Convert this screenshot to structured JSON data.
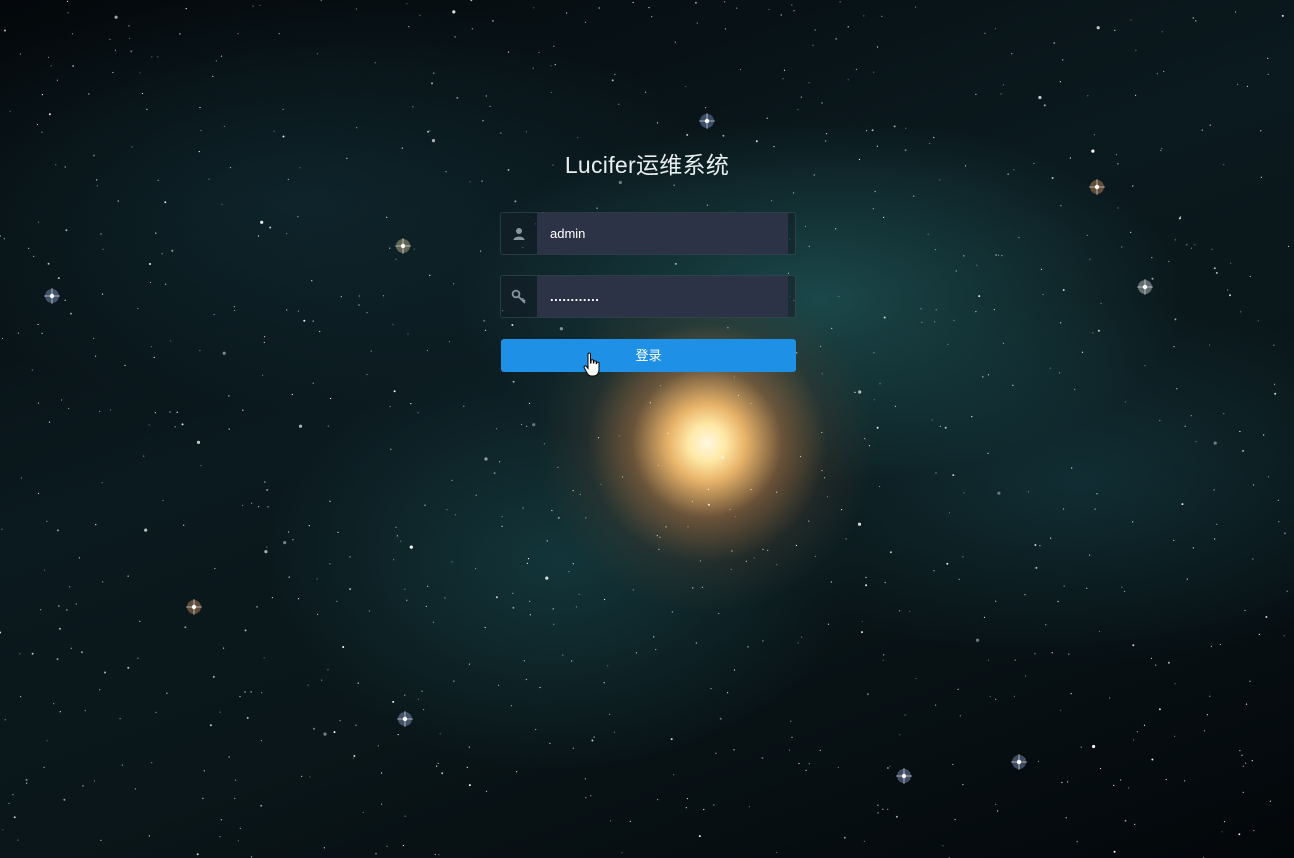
{
  "app": {
    "title": "Lucifer运维系统"
  },
  "login_form": {
    "username": {
      "value": "admin",
      "icon": "user-icon"
    },
    "password": {
      "value": "............",
      "icon": "key-icon"
    },
    "submit_label": "登录"
  },
  "colors": {
    "button": "#1e90e6",
    "input_bg": "#2d3347",
    "title_text": "#e8eef0"
  }
}
